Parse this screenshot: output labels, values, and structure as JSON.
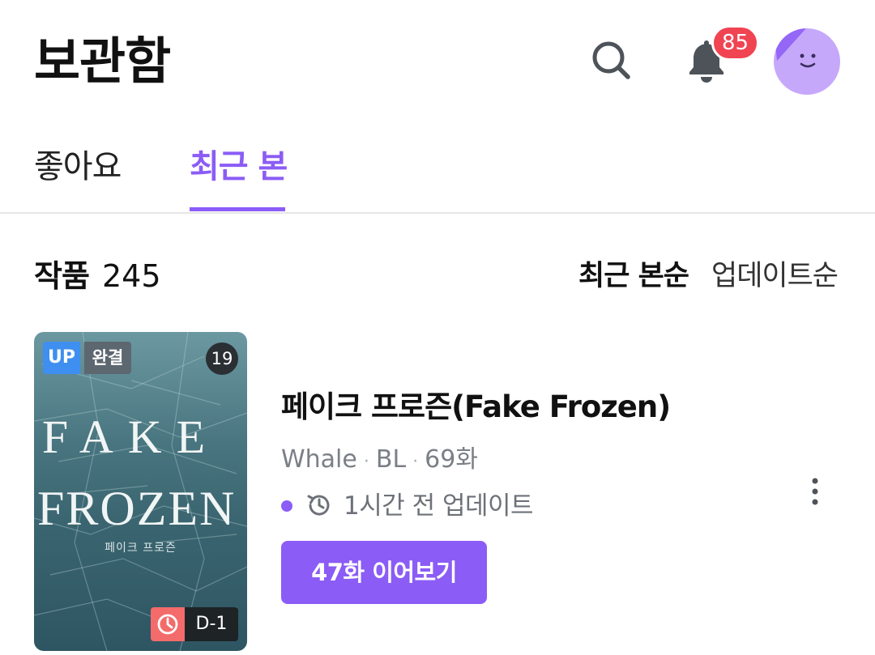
{
  "header": {
    "title": "보관함",
    "notification_count": "85",
    "icons": [
      "search-icon",
      "bell-icon",
      "avatar"
    ]
  },
  "tabs": [
    {
      "label": "좋아요",
      "active": false
    },
    {
      "label": "최근 본",
      "active": true
    }
  ],
  "list_header": {
    "label": "작품",
    "count": "245",
    "sort_options": [
      "최근 본순",
      "업데이트순"
    ],
    "active_sort": "최근 본순"
  },
  "items": [
    {
      "title": "페이크 프로즌(Fake Frozen)",
      "author": "Whale",
      "genre": "BL",
      "episodes": "69화",
      "update_text": "1시간 전 업데이트",
      "continue_label": "47화 이어보기",
      "badges": {
        "up": "UP",
        "complete": "완결",
        "age": "19",
        "dday": "D-1"
      },
      "cover": {
        "line1": "FAKE",
        "line2": "FROZEN",
        "subtitle": "페이크 프로즌"
      }
    }
  ],
  "colors": {
    "accent": "#8b5cf6",
    "badge_red": "#f04452",
    "up_blue": "#3e8fef",
    "timer_red": "#f36b6b"
  }
}
